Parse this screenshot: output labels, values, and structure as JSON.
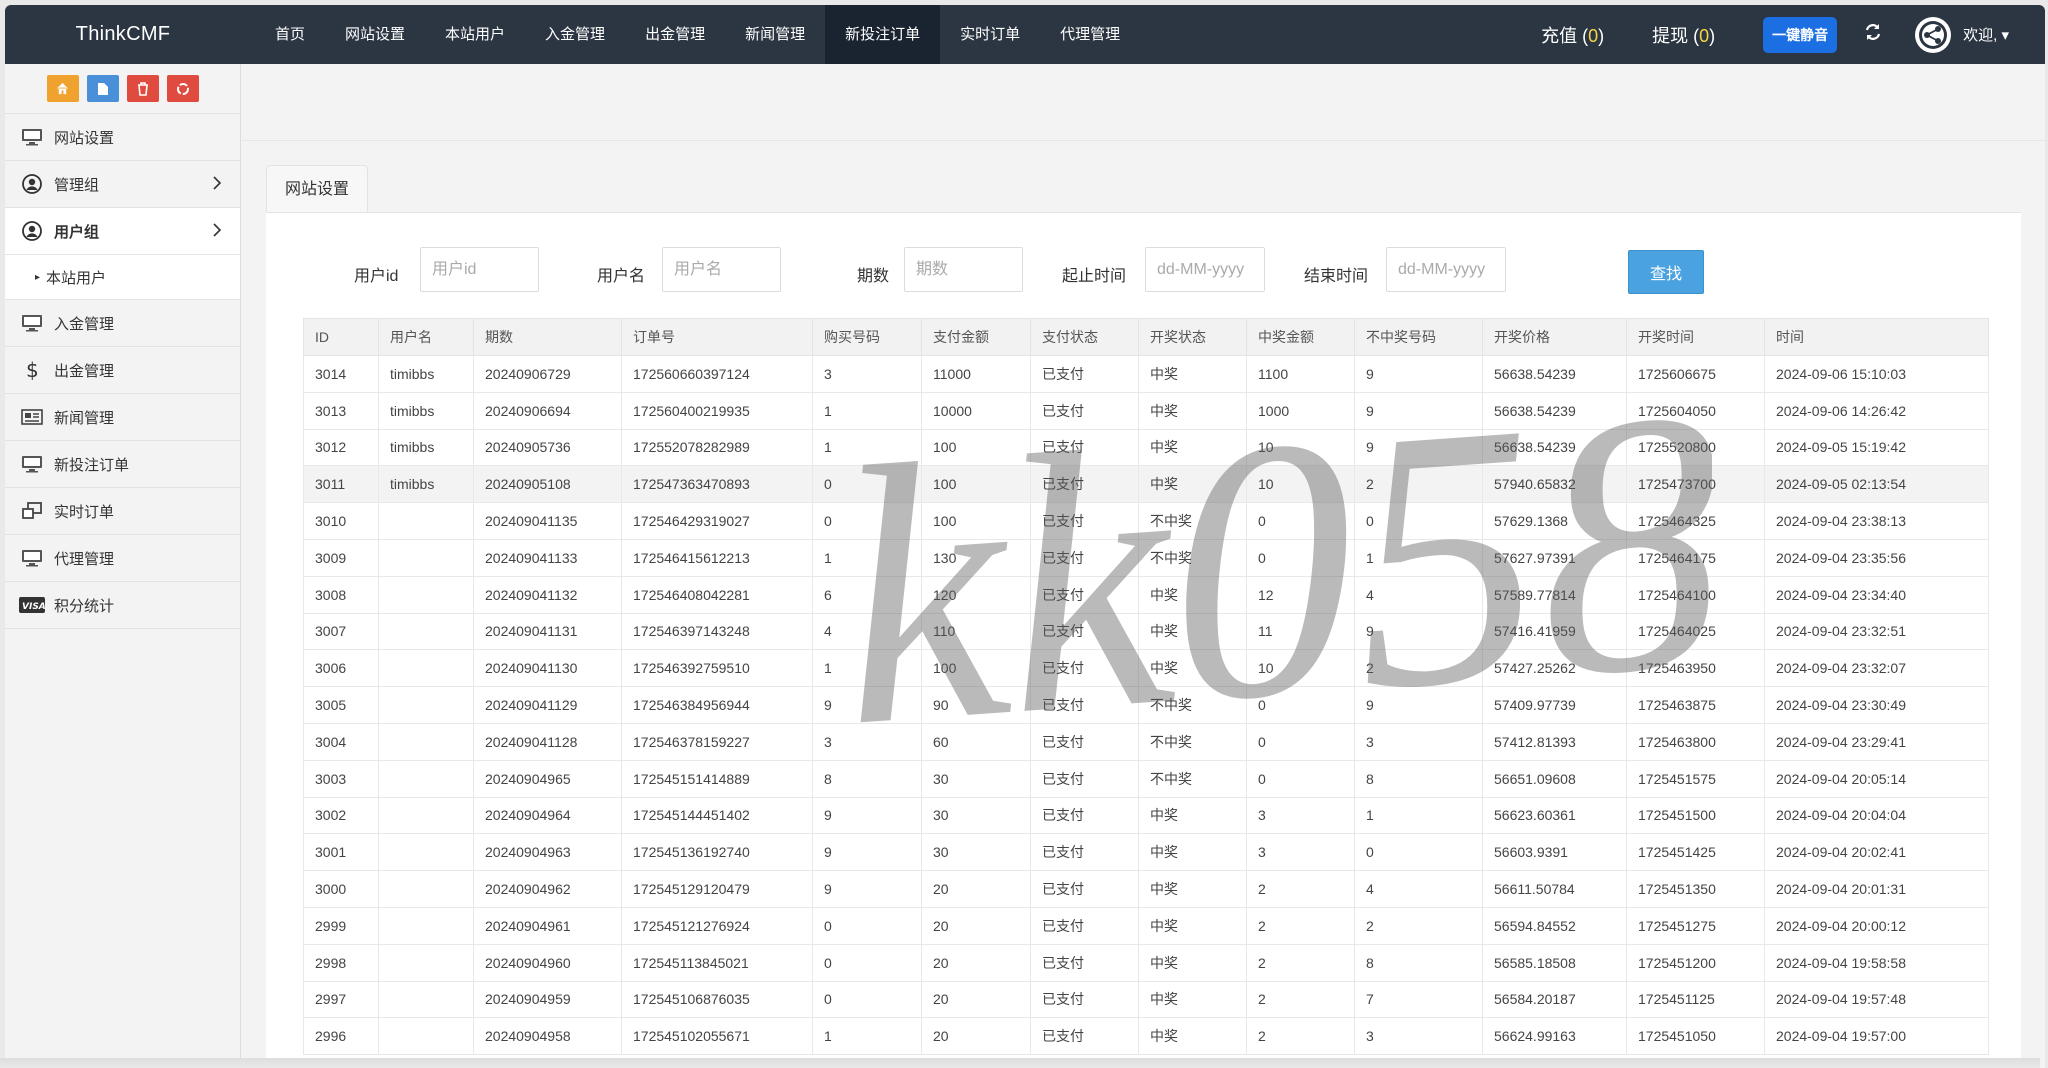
{
  "brand": "ThinkCMF",
  "nav": [
    {
      "label": "首页",
      "active": false
    },
    {
      "label": "网站设置",
      "active": false
    },
    {
      "label": "本站用户",
      "active": false
    },
    {
      "label": "入金管理",
      "active": false
    },
    {
      "label": "出金管理",
      "active": false
    },
    {
      "label": "新闻管理",
      "active": false
    },
    {
      "label": "新投注订单",
      "active": true
    },
    {
      "label": "实时订单",
      "active": false
    },
    {
      "label": "代理管理",
      "active": false
    }
  ],
  "topright": {
    "recharge_label": "充值",
    "recharge_count": "0",
    "withdraw_label": "提现",
    "withdraw_count": "0",
    "mute_label": "一键静音",
    "welcome": "欢迎,"
  },
  "sidebar": {
    "items": [
      {
        "label": "网站设置",
        "icon": "monitor-icon"
      },
      {
        "label": "管理组",
        "icon": "user-circle-icon",
        "chevron": true
      },
      {
        "label": "用户组",
        "icon": "user-circle-icon",
        "chevron": true,
        "active": true
      },
      {
        "label": "本站用户",
        "sub": true
      },
      {
        "label": "入金管理",
        "icon": "monitor-icon"
      },
      {
        "label": "出金管理",
        "icon": "dollar-icon"
      },
      {
        "label": "新闻管理",
        "icon": "newspaper-icon"
      },
      {
        "label": "新投注订单",
        "icon": "monitor-icon"
      },
      {
        "label": "实时订单",
        "icon": "windows-icon"
      },
      {
        "label": "代理管理",
        "icon": "monitor-icon"
      },
      {
        "label": "积分统计",
        "icon": "visa-icon"
      }
    ]
  },
  "tab_label": "网站设置",
  "filters": {
    "userid_label": "用户id",
    "userid_placeholder": "用户id",
    "username_label": "用户名",
    "username_placeholder": "用户名",
    "period_label": "期数",
    "period_placeholder": "期数",
    "start_label": "起止时间",
    "start_placeholder": "dd-MM-yyyy",
    "end_label": "结束时间",
    "end_placeholder": "dd-MM-yyyy",
    "search_label": "查找"
  },
  "table": {
    "headers": [
      "ID",
      "用户名",
      "期数",
      "订单号",
      "购买号码",
      "支付金额",
      "支付状态",
      "开奖状态",
      "中奖金额",
      "不中奖号码",
      "开奖价格",
      "开奖时间",
      "时间"
    ],
    "rows": [
      [
        "3014",
        "timibbs",
        "20240906729",
        "172560660397124",
        "3",
        "11000",
        "已支付",
        "中奖",
        "1100",
        "9",
        "56638.54239",
        "1725606675",
        "2024-09-06 15:10:03"
      ],
      [
        "3013",
        "timibbs",
        "20240906694",
        "172560400219935",
        "1",
        "10000",
        "已支付",
        "中奖",
        "1000",
        "9",
        "56638.54239",
        "1725604050",
        "2024-09-06 14:26:42"
      ],
      [
        "3012",
        "timibbs",
        "20240905736",
        "172552078282989",
        "1",
        "100",
        "已支付",
        "中奖",
        "10",
        "9",
        "56638.54239",
        "1725520800",
        "2024-09-05 15:19:42"
      ],
      [
        "3011",
        "timibbs",
        "20240905108",
        "172547363470893",
        "0",
        "100",
        "已支付",
        "中奖",
        "10",
        "2",
        "57940.65832",
        "1725473700",
        "2024-09-05 02:13:54"
      ],
      [
        "3010",
        "",
        "202409041135",
        "172546429319027",
        "0",
        "100",
        "已支付",
        "不中奖",
        "0",
        "0",
        "57629.1368",
        "1725464325",
        "2024-09-04 23:38:13"
      ],
      [
        "3009",
        "",
        "202409041133",
        "172546415612213",
        "1",
        "130",
        "已支付",
        "不中奖",
        "0",
        "1",
        "57627.97391",
        "1725464175",
        "2024-09-04 23:35:56"
      ],
      [
        "3008",
        "",
        "202409041132",
        "172546408042281",
        "6",
        "120",
        "已支付",
        "中奖",
        "12",
        "4",
        "57589.77814",
        "1725464100",
        "2024-09-04 23:34:40"
      ],
      [
        "3007",
        "",
        "202409041131",
        "172546397143248",
        "4",
        "110",
        "已支付",
        "中奖",
        "11",
        "9",
        "57416.41959",
        "1725464025",
        "2024-09-04 23:32:51"
      ],
      [
        "3006",
        "",
        "202409041130",
        "172546392759510",
        "1",
        "100",
        "已支付",
        "中奖",
        "10",
        "2",
        "57427.25262",
        "1725463950",
        "2024-09-04 23:32:07"
      ],
      [
        "3005",
        "",
        "202409041129",
        "172546384956944",
        "9",
        "90",
        "已支付",
        "不中奖",
        "0",
        "9",
        "57409.97739",
        "1725463875",
        "2024-09-04 23:30:49"
      ],
      [
        "3004",
        "",
        "202409041128",
        "172546378159227",
        "3",
        "60",
        "已支付",
        "不中奖",
        "0",
        "3",
        "57412.81393",
        "1725463800",
        "2024-09-04 23:29:41"
      ],
      [
        "3003",
        "",
        "20240904965",
        "172545151414889",
        "8",
        "30",
        "已支付",
        "不中奖",
        "0",
        "8",
        "56651.09608",
        "1725451575",
        "2024-09-04 20:05:14"
      ],
      [
        "3002",
        "",
        "20240904964",
        "172545144451402",
        "9",
        "30",
        "已支付",
        "中奖",
        "3",
        "1",
        "56623.60361",
        "1725451500",
        "2024-09-04 20:04:04"
      ],
      [
        "3001",
        "",
        "20240904963",
        "172545136192740",
        "9",
        "30",
        "已支付",
        "中奖",
        "3",
        "0",
        "56603.9391",
        "1725451425",
        "2024-09-04 20:02:41"
      ],
      [
        "3000",
        "",
        "20240904962",
        "172545129120479",
        "9",
        "20",
        "已支付",
        "中奖",
        "2",
        "4",
        "56611.50784",
        "1725451350",
        "2024-09-04 20:01:31"
      ],
      [
        "2999",
        "",
        "20240904961",
        "172545121276924",
        "0",
        "20",
        "已支付",
        "中奖",
        "2",
        "2",
        "56594.84552",
        "1725451275",
        "2024-09-04 20:00:12"
      ],
      [
        "2998",
        "",
        "20240904960",
        "172545113845021",
        "0",
        "20",
        "已支付",
        "中奖",
        "2",
        "8",
        "56585.18508",
        "1725451200",
        "2024-09-04 19:58:58"
      ],
      [
        "2997",
        "",
        "20240904959",
        "172545106876035",
        "0",
        "20",
        "已支付",
        "中奖",
        "2",
        "7",
        "56584.20187",
        "1725451125",
        "2024-09-04 19:57:48"
      ],
      [
        "2996",
        "",
        "20240904958",
        "172545102055671",
        "1",
        "20",
        "已支付",
        "中奖",
        "2",
        "3",
        "56624.99163",
        "1725451050",
        "2024-09-04 19:57:00"
      ]
    ],
    "highlight_row": 3
  },
  "watermark": "kk058",
  "colors": {
    "topbar": "#2b3642",
    "accent_yellow": "#f5d547",
    "mute_btn": "#1b6fe3",
    "search_btn": "#4aa3e0"
  }
}
